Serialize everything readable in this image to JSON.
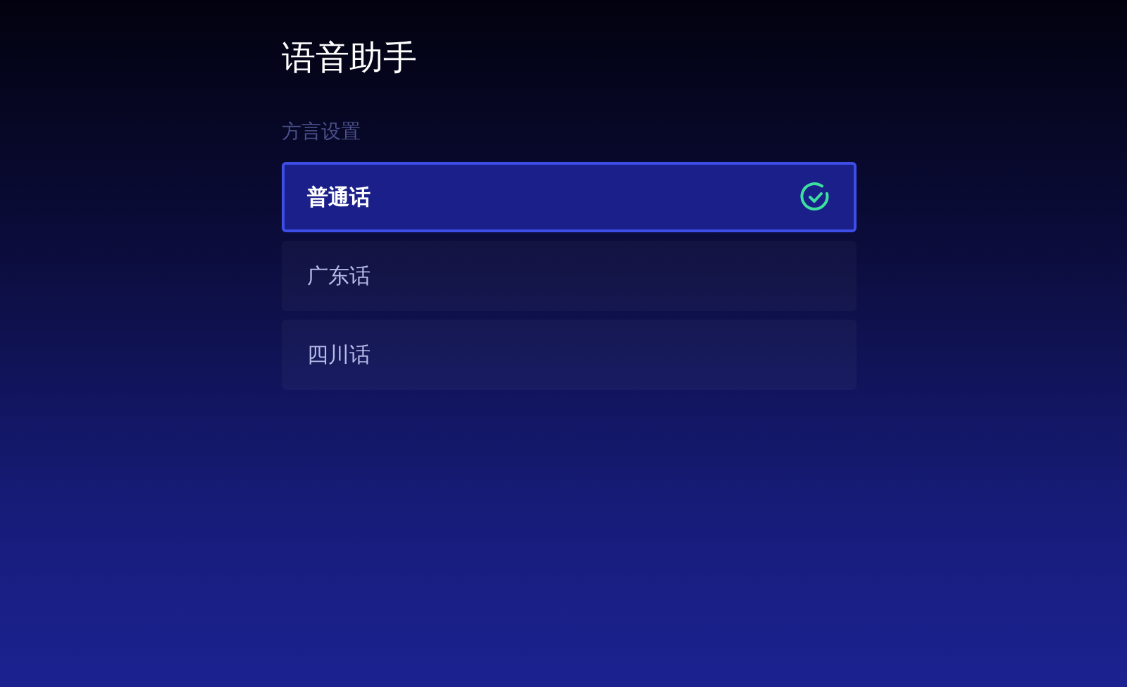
{
  "title": "语音助手",
  "section": {
    "label": "方言设置"
  },
  "options": [
    {
      "label": "普通话",
      "selected": true
    },
    {
      "label": "广东话",
      "selected": false
    },
    {
      "label": "四川话",
      "selected": false
    }
  ]
}
